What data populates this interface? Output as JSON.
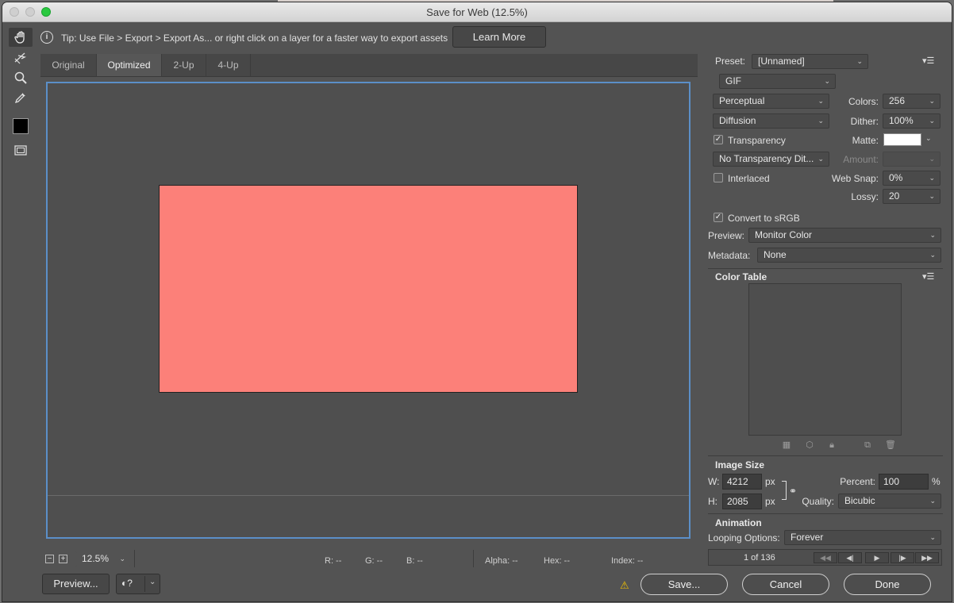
{
  "window": {
    "title": "Save for Web (12.5%)"
  },
  "tools": [
    {
      "name": "hand-tool-icon"
    },
    {
      "name": "slice-select-tool-icon"
    },
    {
      "name": "zoom-tool-icon"
    },
    {
      "name": "eyedropper-tool-icon"
    },
    {
      "name": "eyedropper-color-swatch",
      "color": "#000000"
    },
    {
      "name": "toggle-slices-icon"
    }
  ],
  "tip": {
    "text": "Tip: Use File > Export > Export As...  or right click on a layer for a faster way to export assets",
    "learn_more": "Learn More"
  },
  "tabs": [
    "Original",
    "Optimized",
    "2-Up",
    "4-Up"
  ],
  "active_tab": "Optimized",
  "canvas": {
    "image_color": "#fc8079",
    "frame_color": "#5b8fc8"
  },
  "status": {
    "zoom": "12.5%",
    "r": "R: --",
    "g": "G: --",
    "b": "B: --",
    "alpha": "Alpha: --",
    "hex": "Hex: --",
    "index": "Index: --"
  },
  "settings": {
    "preset_label": "Preset:",
    "preset_value": "[Unnamed]",
    "format": "GIF",
    "reduction": "Perceptual",
    "colors_label": "Colors:",
    "colors_value": "256",
    "dither_algo": "Diffusion",
    "dither_label": "Dither:",
    "dither_value": "100%",
    "transparency_label": "Transparency",
    "transparency_checked": true,
    "matte_label": "Matte:",
    "matte_color": "#ffffff",
    "transparency_dither": "No Transparency Dit...",
    "amount_label": "Amount:",
    "interlaced_label": "Interlaced",
    "interlaced_checked": false,
    "websnap_label": "Web Snap:",
    "websnap_value": "0%",
    "lossy_label": "Lossy:",
    "lossy_value": "20",
    "convert_label": "Convert to sRGB",
    "convert_checked": true,
    "preview_label": "Preview:",
    "preview_value": "Monitor Color",
    "metadata_label": "Metadata:",
    "metadata_value": "None"
  },
  "color_table": {
    "title": "Color Table"
  },
  "image_size": {
    "title": "Image Size",
    "w_label": "W:",
    "w_value": "4212",
    "w_unit": "px",
    "h_label": "H:",
    "h_value": "2085",
    "h_unit": "px",
    "percent_label": "Percent:",
    "percent_value": "100",
    "percent_unit": "%",
    "quality_label": "Quality:",
    "quality_value": "Bicubic"
  },
  "animation": {
    "title": "Animation",
    "looping_label": "Looping Options:",
    "looping_value": "Forever",
    "frame_counter": "1 of 136"
  },
  "buttons": {
    "preview": "Preview...",
    "save": "Save...",
    "cancel": "Cancel",
    "done": "Done"
  }
}
